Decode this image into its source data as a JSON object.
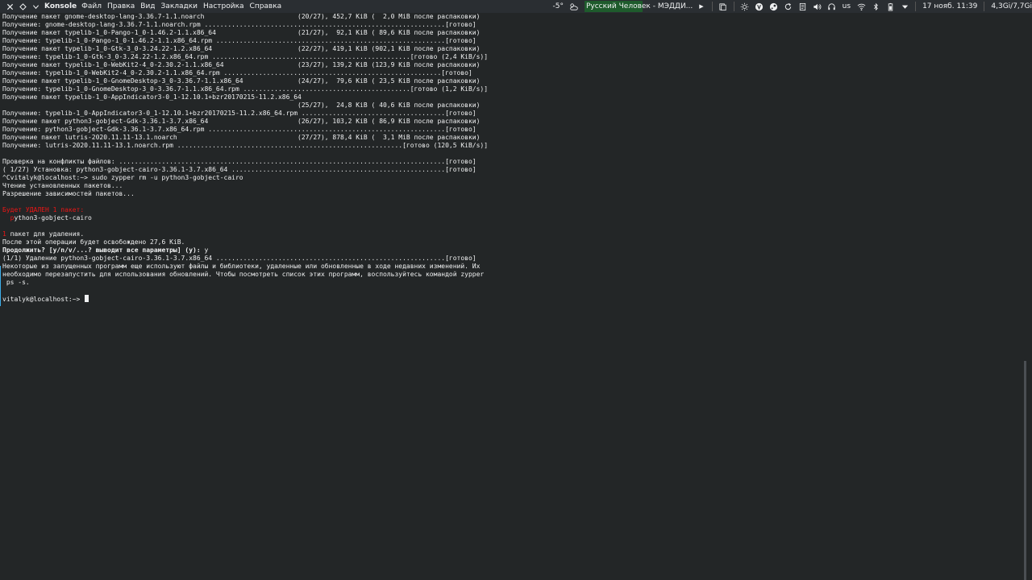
{
  "menubar": {
    "app_name": "Konsole",
    "items": [
      "Файл",
      "Правка",
      "Вид",
      "Закладки",
      "Настройка",
      "Справка"
    ]
  },
  "tray": {
    "temperature": "-5°",
    "media_title": "Русский Человек - МЭДДИ...",
    "keyboard_layout": "us",
    "datetime": "17 нояб. 11:39",
    "memory": "4,3Gi/7,7Gi"
  },
  "terminal": {
    "lines": [
      [
        {
          "t": "Получение пакет gnome-desktop-lang-3.36.7-1.1.noarch                        (20/27), 452,7 KiB (  2,0 MiB после распаковки)"
        }
      ],
      [
        {
          "t": "Получение: gnome-desktop-lang-3.36.7-1.1.noarch.rpm ..............................................................[готово]"
        }
      ],
      [
        {
          "t": "Получение пакет typelib-1_0-Pango-1_0-1.46.2-1.1.x86_64                     (21/27),  92,1 KiB ( 89,6 KiB после распаковки)"
        }
      ],
      [
        {
          "t": "Получение: typelib-1_0-Pango-1_0-1.46.2-1.1.x86_64.rpm ...........................................................[готово]"
        }
      ],
      [
        {
          "t": "Получение пакет typelib-1_0-Gtk-3_0-3.24.22-1.2.x86_64                      (22/27), 419,1 KiB (902,1 KiB после распаковки)"
        }
      ],
      [
        {
          "t": "Получение: typelib-1_0-Gtk-3_0-3.24.22-1.2.x86_64.rpm ...................................................[готово (2,4 KiB/s)]"
        }
      ],
      [
        {
          "t": "Получение пакет typelib-1_0-WebKit2-4_0-2.30.2-1.1.x86_64                   (23/27), 139,2 KiB (123,9 KiB после распаковки)"
        }
      ],
      [
        {
          "t": "Получение: typelib-1_0-WebKit2-4_0-2.30.2-1.1.x86_64.rpm ........................................................[готово]"
        }
      ],
      [
        {
          "t": "Получение пакет typelib-1_0-GnomeDesktop-3_0-3.36.7-1.1.x86_64              (24/27),  79,6 KiB ( 23,5 KiB после распаковки)"
        }
      ],
      [
        {
          "t": "Получение: typelib-1_0-GnomeDesktop-3_0-3.36.7-1.1.x86_64.rpm ...........................................[готово (1,2 KiB/s)]"
        }
      ],
      [
        {
          "t": "Получение пакет typelib-1_0-AppIndicator3-0_1-12.10.1+bzr20170215-11.2.x86_64"
        }
      ],
      [
        {
          "t": "                                                                            (25/27),  24,8 KiB ( 40,6 KiB после распаковки)"
        }
      ],
      [
        {
          "t": "Получение: typelib-1_0-AppIndicator3-0_1-12.10.1+bzr20170215-11.2.x86_64.rpm .....................................[готово]"
        }
      ],
      [
        {
          "t": "Получение пакет python3-gobject-Gdk-3.36.1-3.7.x86_64                       (26/27), 103,2 KiB ( 86,9 KiB после распаковки)"
        }
      ],
      [
        {
          "t": "Получение: python3-gobject-Gdk-3.36.1-3.7.x86_64.rpm .............................................................[готово]"
        }
      ],
      [
        {
          "t": "Получение пакет lutris-2020.11.11-13.1.noarch                               (27/27), 878,4 KiB (  3,1 MiB после распаковки)"
        }
      ],
      [
        {
          "t": "Получение: lutris-2020.11.11-13.1.noarch.rpm ..........................................................[готово (120,5 KiB/s)]"
        }
      ],
      [],
      [
        {
          "t": "Проверка на конфликты файлов: ....................................................................................[готово]"
        }
      ],
      [
        {
          "t": "( 1/27) Установка: python3-gobject-cairo-3.36.1-3.7.x86_64 .......................................................[готово]"
        }
      ],
      [
        {
          "t": "^Cvitalyk@localhost:~> sudo zypper rm -u python3-gobject-cairo"
        }
      ],
      [
        {
          "t": "Чтение установленных пакетов..."
        }
      ],
      [
        {
          "t": "Разрешение зависимостей пакетов..."
        }
      ],
      [],
      [
        {
          "t": "Будет УДАЛЕН 1 пакет:",
          "c": "red"
        }
      ],
      [
        {
          "t": "  "
        },
        {
          "t": "p",
          "c": "red"
        },
        {
          "t": "ython3-gobject-cairo"
        }
      ],
      [],
      [
        {
          "t": "1",
          "c": "red"
        },
        {
          "t": " пакет для удаления."
        }
      ],
      [
        {
          "t": "После этой операции будет освобождено 27,6 KiB."
        }
      ],
      [
        {
          "t": "Продолжить? [y/n/v/...? выводит все параметры] (y): ",
          "c": "bold"
        },
        {
          "t": "y"
        }
      ],
      [
        {
          "t": "(1/1) Удаление python3-gobject-cairo-3.36.1-3.7.x86_64 ...........................................................[готово]"
        }
      ],
      [
        {
          "t": "Некоторые из запущенных программ еще используют файлы и библиотеки, удаленные или обновленные в ходе недавних изменений. Их"
        }
      ],
      [
        {
          "t": "необходимо перезапустить для использования обновлений. Чтобы посмотреть список этих программ, воспользуйтесь командой zypper"
        }
      ],
      [
        {
          "t": " ps -s."
        }
      ],
      [],
      [
        {
          "t": "vitalyk@localhost:~> "
        },
        {
          "cursor": true
        }
      ]
    ]
  }
}
